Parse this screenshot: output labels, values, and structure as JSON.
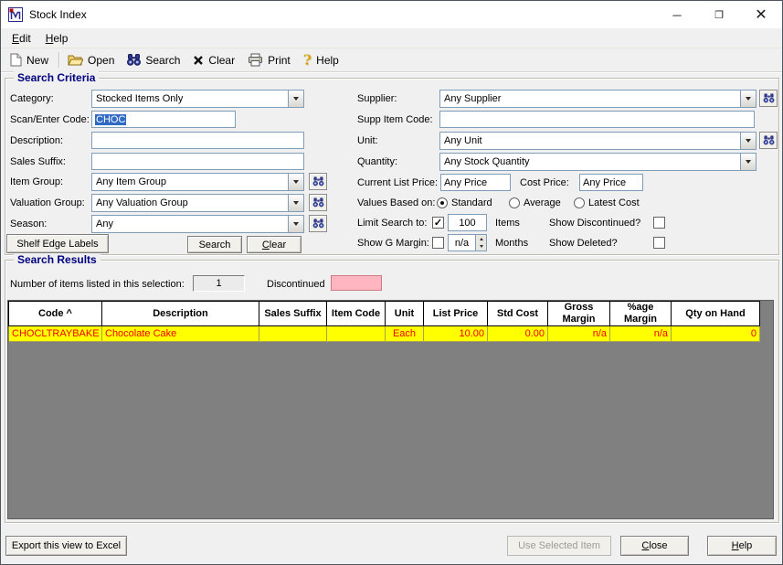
{
  "window": {
    "title": "Stock Index",
    "minimize_glyph": "─",
    "maximize_glyph": "❐",
    "close_glyph": "✕"
  },
  "menu": {
    "edit": "Edit",
    "help": "Help"
  },
  "toolbar": {
    "new": "New",
    "open": "Open",
    "search": "Search",
    "clear": "Clear",
    "print": "Print",
    "help": "Help"
  },
  "criteria": {
    "title": "Search Criteria",
    "category_label": "Category:",
    "category_value": "Stocked Items Only",
    "scan_label": "Scan/Enter Code:",
    "scan_value": "CHOC",
    "description_label": "Description:",
    "description_value": "",
    "sales_suffix_label": "Sales Suffix:",
    "sales_suffix_value": "",
    "item_group_label": "Item Group:",
    "item_group_value": "Any Item Group",
    "valuation_group_label": "Valuation Group:",
    "valuation_group_value": "Any Valuation Group",
    "season_label": "Season:",
    "season_value": "Any",
    "shelf_edge_labels": "Shelf Edge Labels",
    "search_btn": "Search",
    "clear_btn": "Clear",
    "supplier_label": "Supplier:",
    "supplier_value": "Any Supplier",
    "supp_item_code_label": "Supp Item Code:",
    "supp_item_code_value": "",
    "unit_label": "Unit:",
    "unit_value": "Any Unit",
    "quantity_label": "Quantity:",
    "quantity_value": "Any Stock Quantity",
    "list_price_label": "Current List Price:",
    "list_price_value": "Any Price",
    "cost_price_label": "Cost Price:",
    "cost_price_value": "Any Price",
    "values_based_label": "Values Based on:",
    "radio_standard": "Standard",
    "radio_average": "Average",
    "radio_latest": "Latest Cost",
    "values_selected": "Standard",
    "limit_label": "Limit Search to:",
    "limit_checked": true,
    "limit_value": "100",
    "limit_units": "Items",
    "show_discontinued_label": "Show Discontinued?",
    "show_discontinued_checked": false,
    "gmargin_label": "Show G Margin:",
    "gmargin_checked": false,
    "gmargin_value": "n/a",
    "gmargin_units": "Months",
    "show_deleted_label": "Show Deleted?",
    "show_deleted_checked": false
  },
  "results": {
    "title": "Search Results",
    "count_label": "Number of items listed in this selection:",
    "count_value": "1",
    "discontinued_label": "Discontinued",
    "columns": [
      "Code ^",
      "Description",
      "Sales Suffix",
      "Item Code",
      "Unit",
      "List Price",
      "Std Cost",
      "Gross Margin",
      "%age Margin",
      "Qty on Hand"
    ],
    "rows": [
      [
        "CHOCLTRAYBAKE",
        "Chocolate Cake",
        "",
        "",
        "Each",
        "10.00",
        "0.00",
        "n/a",
        "n/a",
        "0"
      ]
    ]
  },
  "footer": {
    "export": "Export this view to Excel",
    "use_selected": "Use Selected Item",
    "close": "Close",
    "help": "Help"
  },
  "colors": {
    "selected_row_bg": "#ffff00",
    "selected_row_text": "#ee0000",
    "discontinued_swatch": "#ffb6c1",
    "text_selection_highlight": "#316ac5",
    "group_title": "#000080",
    "grid_background": "#808080"
  }
}
